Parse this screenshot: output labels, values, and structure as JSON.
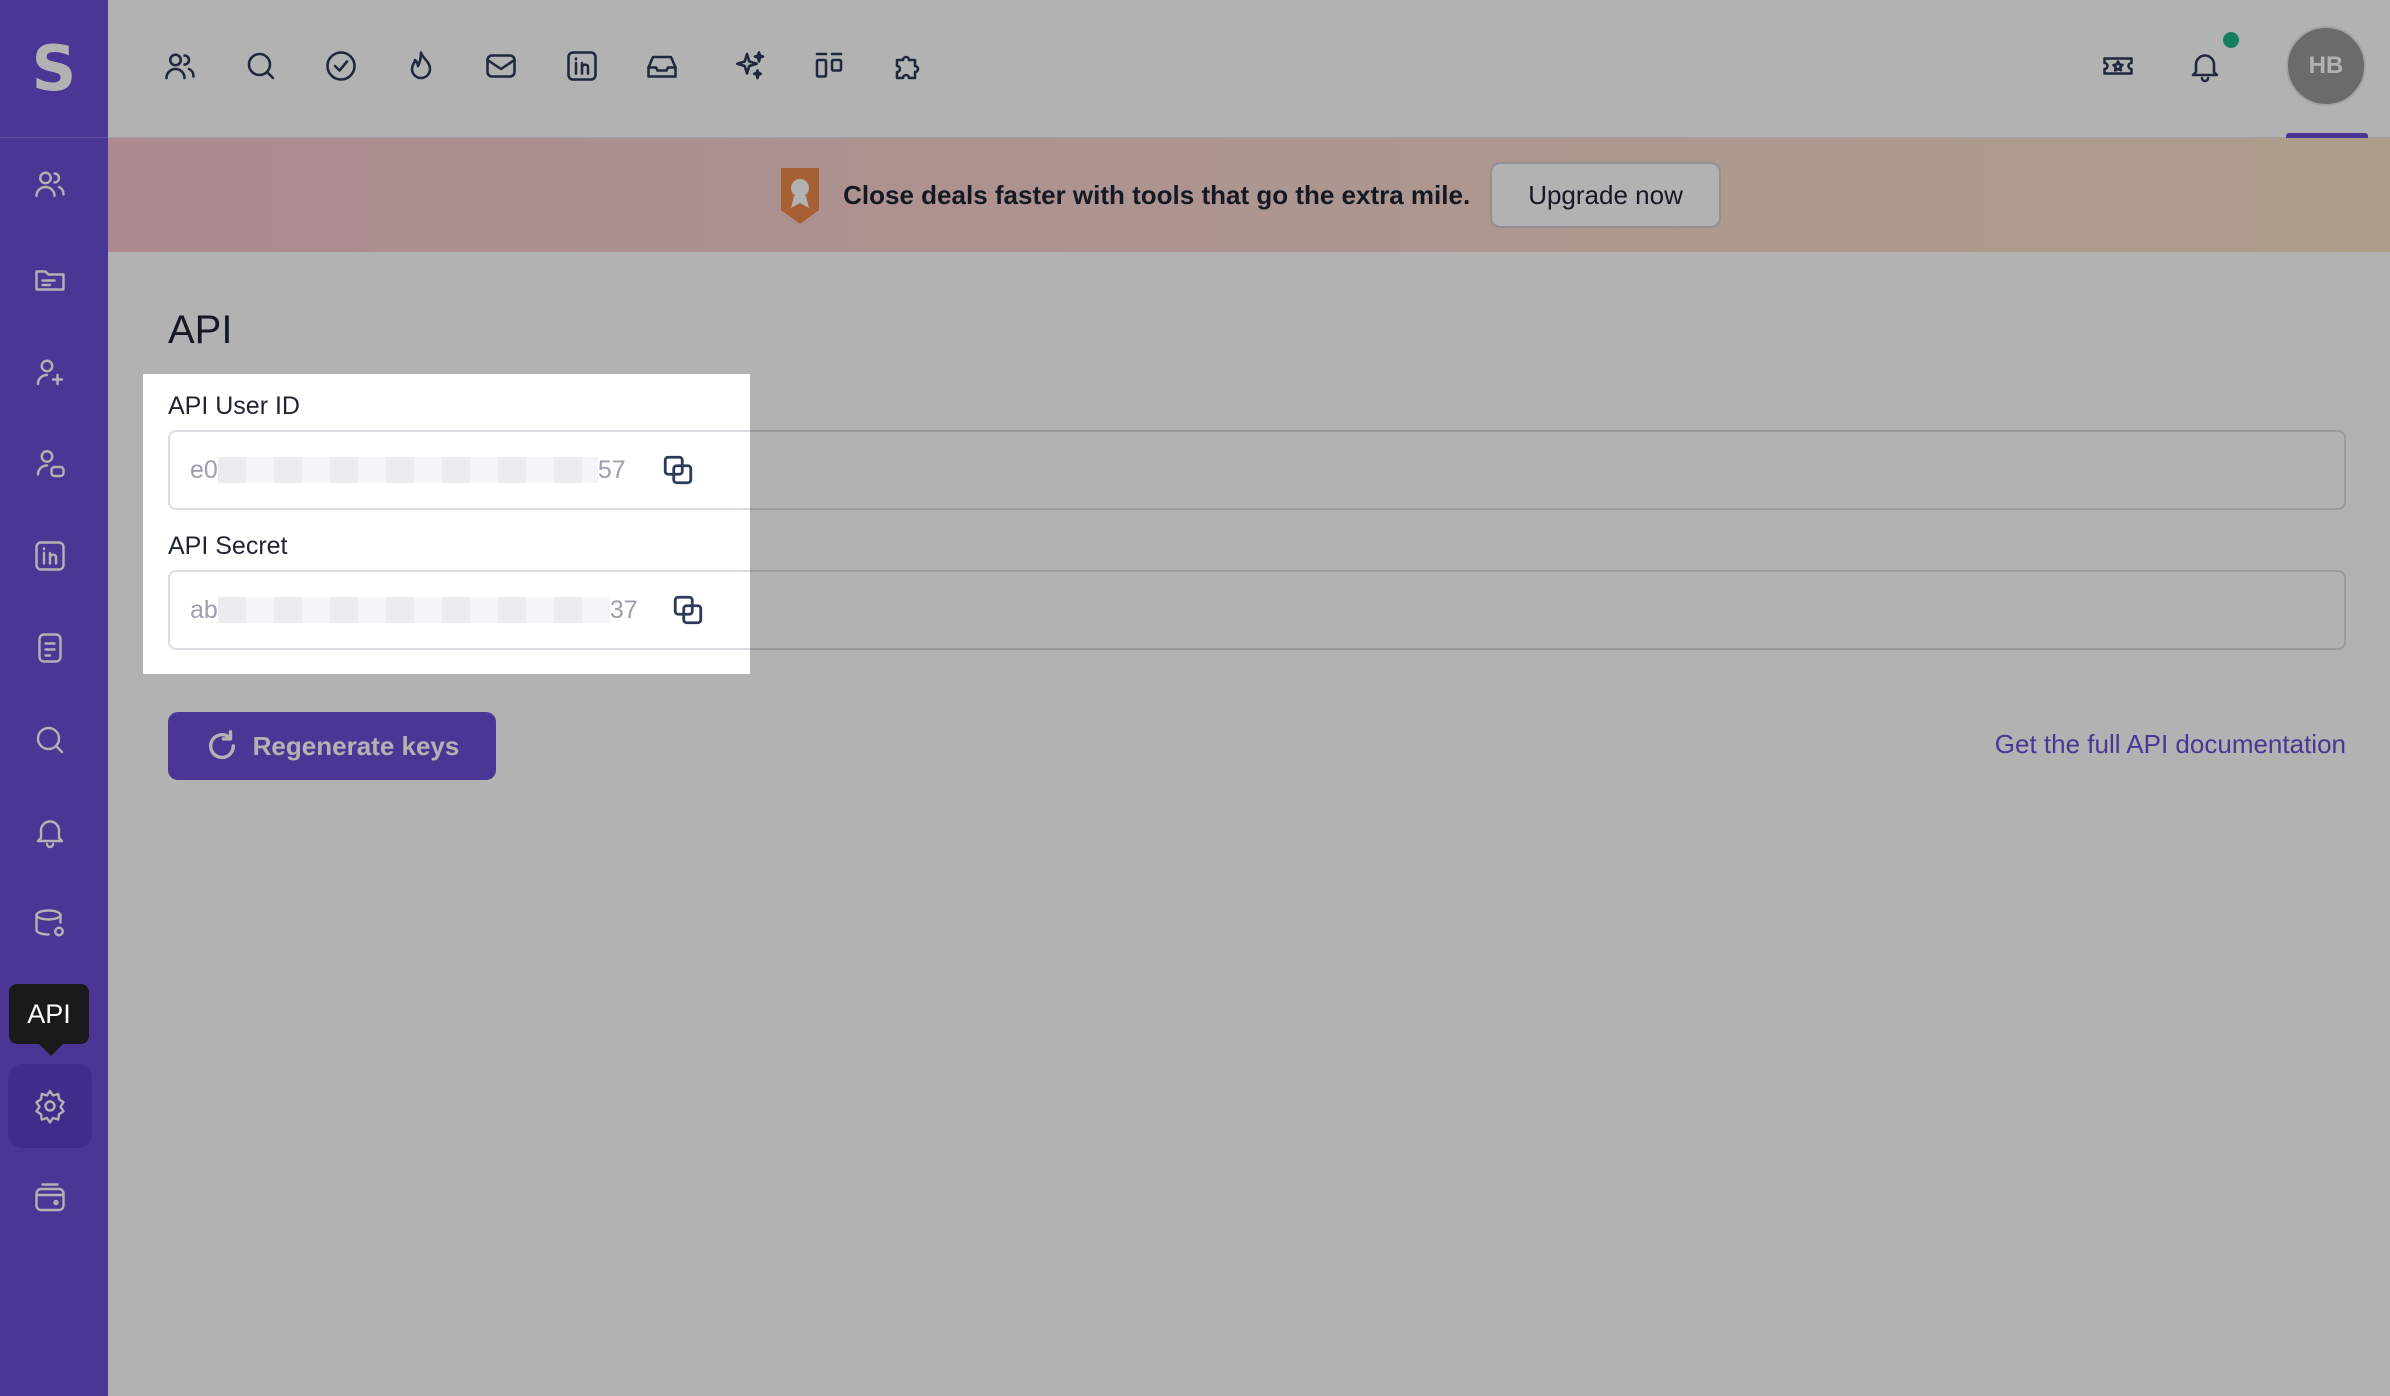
{
  "app": {
    "logo_letter": "S",
    "accent_color": "#6a4fd6"
  },
  "sidebar": {
    "items": [
      {
        "name": "contacts",
        "icon": "users-icon"
      },
      {
        "name": "campaigns",
        "icon": "folder-icon"
      },
      {
        "name": "add-contact",
        "icon": "user-plus-icon"
      },
      {
        "name": "team",
        "icon": "user-group-icon"
      },
      {
        "name": "linkedin",
        "icon": "linkedin-icon"
      },
      {
        "name": "notes",
        "icon": "document-icon"
      },
      {
        "name": "search",
        "icon": "search-icon"
      },
      {
        "name": "notifications",
        "icon": "bell-icon"
      },
      {
        "name": "integrations",
        "icon": "database-icon"
      },
      {
        "name": "settings",
        "icon": "gear-icon",
        "active": true
      },
      {
        "name": "billing",
        "icon": "wallet-icon"
      }
    ],
    "tooltip": "API"
  },
  "topbar": {
    "icons": [
      "users-icon",
      "search-icon",
      "check-circle-icon",
      "flame-icon",
      "mail-icon",
      "linkedin-icon",
      "inbox-icon",
      "sparkles-icon",
      "kanban-icon",
      "puzzle-icon"
    ],
    "right_icons": [
      "ticket-icon",
      "bell-icon"
    ],
    "avatar_initials": "HB",
    "notification_dot_color": "#1db58a"
  },
  "banner": {
    "text": "Close deals faster with tools that go the extra mile.",
    "button_label": "Upgrade now"
  },
  "main": {
    "title": "API",
    "user_id": {
      "label": "API User ID",
      "value_start": "e0",
      "value_end": "57"
    },
    "secret": {
      "label": "API Secret",
      "value_start": "ab",
      "value_end": "37"
    },
    "regenerate_label": "Regenerate keys",
    "doc_link": "Get the full API documentation"
  }
}
